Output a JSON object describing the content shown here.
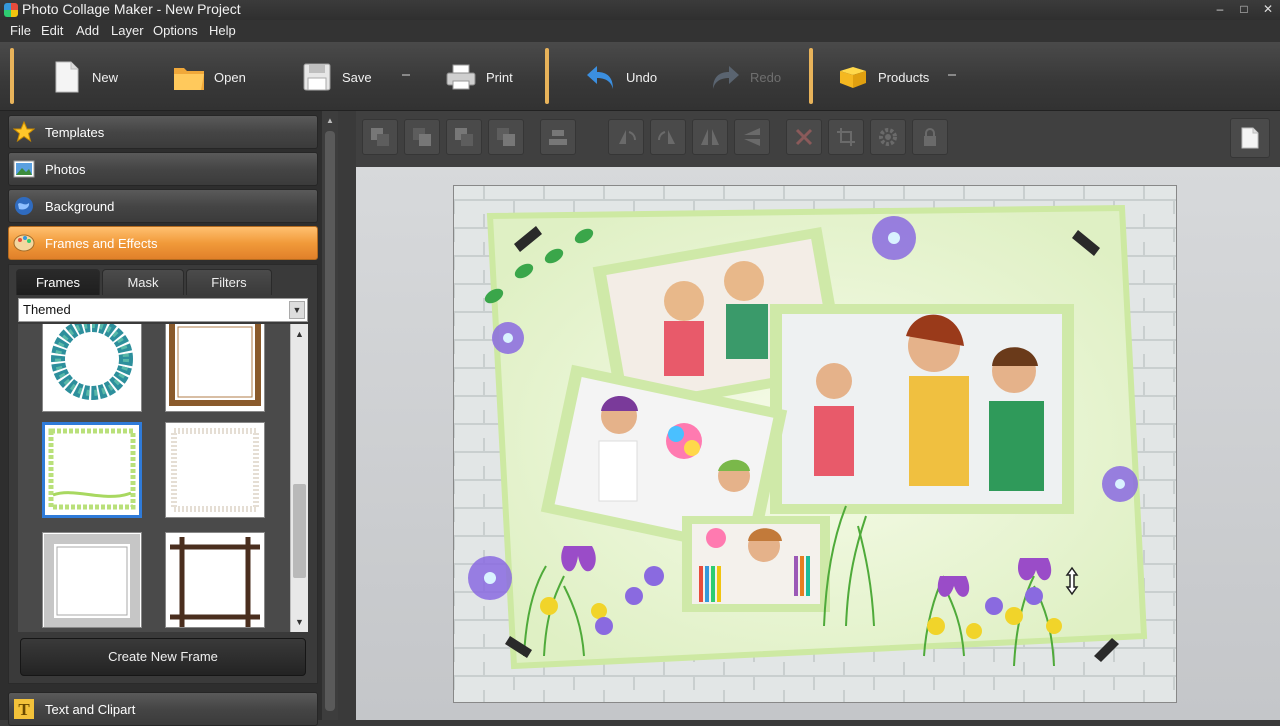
{
  "window": {
    "title": "Photo Collage Maker - New Project",
    "controls": [
      "–",
      "□",
      "✕"
    ]
  },
  "menu": [
    "File",
    "Edit",
    "Add",
    "Layer",
    "Options",
    "Help"
  ],
  "toolbar": {
    "new_label": "New",
    "open_label": "Open",
    "save_label": "Save",
    "print_label": "Print",
    "undo_label": "Undo",
    "redo_label": "Redo",
    "products_label": "Products"
  },
  "sidebar": {
    "sections": [
      {
        "label": "Templates",
        "icon": "star-icon"
      },
      {
        "label": "Photos",
        "icon": "photos-icon"
      },
      {
        "label": "Background",
        "icon": "background-icon"
      },
      {
        "label": "Frames and Effects",
        "icon": "palette-icon",
        "active": true
      }
    ],
    "bottom_section": {
      "label": "Text and Clipart",
      "icon": "text-t-icon"
    },
    "tabs": [
      "Frames",
      "Mask",
      "Filters"
    ],
    "active_tab": "Frames",
    "category_select": {
      "value": "Themed"
    },
    "frames": [
      {
        "name": "bead-ring-frame",
        "selected": false
      },
      {
        "name": "wood-frame",
        "selected": false
      },
      {
        "name": "green-stamp-frame",
        "selected": true
      },
      {
        "name": "white-grunge-frame",
        "selected": false
      },
      {
        "name": "silver-frame",
        "selected": false
      },
      {
        "name": "stick-frame",
        "selected": false
      }
    ],
    "create_button_label": "Create New Frame"
  },
  "canvas_toolbar": {
    "tools": [
      "bring-to-front-icon",
      "bring-forward-icon",
      "send-backward-icon",
      "send-to-back-icon",
      "align-icon",
      "rotate-left-icon",
      "rotate-right-icon",
      "flip-horizontal-icon",
      "flip-vertical-icon",
      "delete-icon",
      "crop-icon",
      "settings-icon",
      "lock-icon",
      "page-icon"
    ]
  },
  "colors": {
    "accent_orange": "#f19a3a",
    "separator_gold": "#e8b35a",
    "selection_blue": "#2f7bd9"
  }
}
